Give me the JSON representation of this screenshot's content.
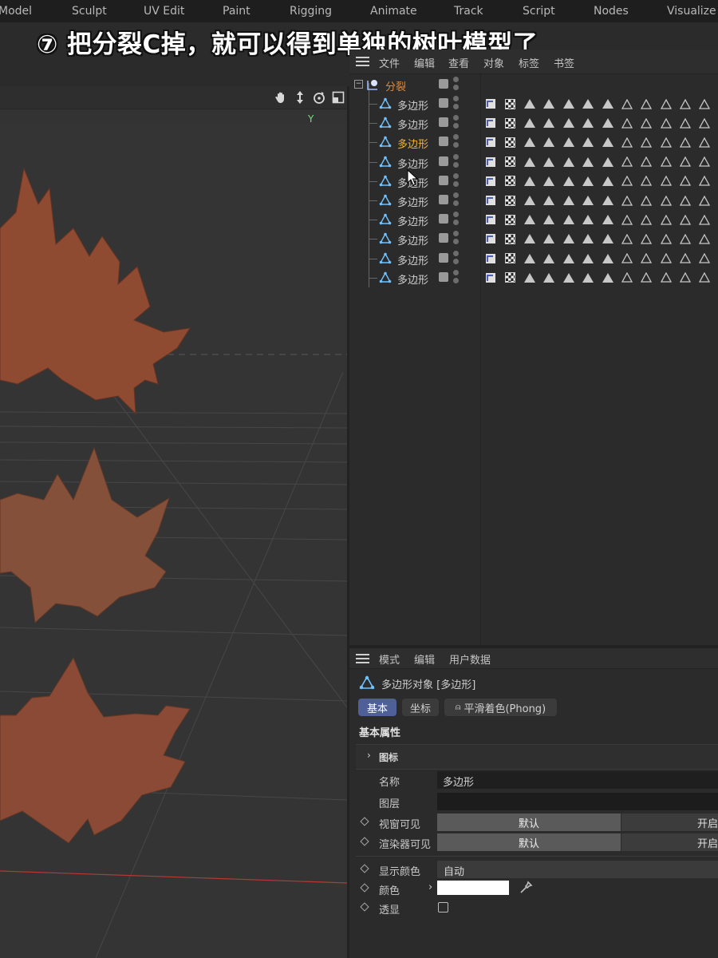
{
  "menubar": [
    "Model",
    "Sculpt",
    "UV Edit",
    "Paint",
    "Rigging",
    "Animate",
    "Track",
    "Script",
    "Nodes",
    "Visualize"
  ],
  "caption": "⑦ 把分裂C掉，就可以得到单独的树叶模型了",
  "viewport": {
    "axis_label": "Y"
  },
  "object_manager": {
    "menu": [
      "文件",
      "编辑",
      "查看",
      "对象",
      "标签",
      "书签"
    ],
    "root_label": "分裂",
    "child_labels": [
      "多边形",
      "多边形",
      "多边形",
      "多边形",
      "多边形",
      "多边形",
      "多边形",
      "多边形",
      "多边形",
      "多边形"
    ],
    "selected_index": 2
  },
  "attribute_manager": {
    "menu": [
      "模式",
      "编辑",
      "用户数据"
    ],
    "object_title": "多边形对象 [多边形]",
    "tabs": [
      "基本",
      "坐标",
      "平滑着色(Phong)"
    ],
    "section_title": "基本属性",
    "group_label": "图标",
    "name_label": "名称",
    "name_value": "多边形",
    "layer_label": "图层",
    "viewport_visible_label": "视窗可见",
    "viewport_visible_value": "默认",
    "viewport_visible_alt": "开启",
    "renderer_visible_label": "渲染器可见",
    "renderer_visible_value": "默认",
    "renderer_visible_alt": "开启",
    "display_color_label": "显示颜色",
    "display_color_value": "自动",
    "color_label": "颜色",
    "color_value": "#ffffff",
    "transparency_label": "透显"
  },
  "colors": {
    "accent": "#4f5f98",
    "selected_text": "#f2b531",
    "root_text": "#e0893a"
  }
}
